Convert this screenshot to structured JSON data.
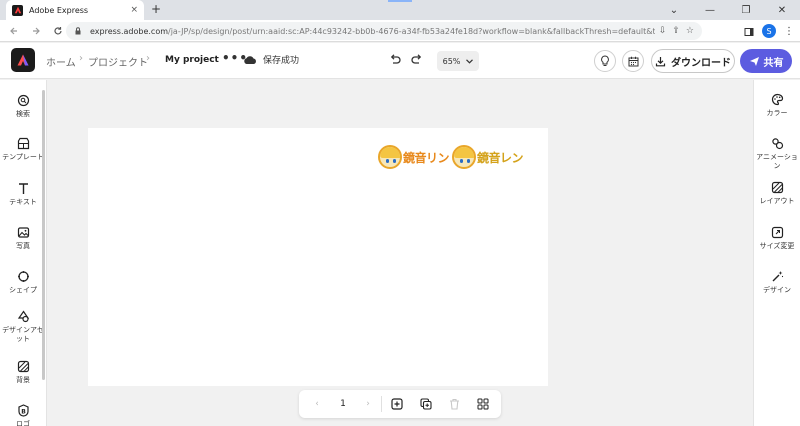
{
  "browser": {
    "tab_title": "Adobe Express",
    "tab_close": "×",
    "new_tab": "+",
    "url_host": "express.adobe.com",
    "url_path": "/ja-JP/sp/design/post/urn:aaid:sc:AP:44c93242-bb0b-4676-a34f-fb53a24fe18d?workflow=blank&fallbackThresh=default&trigger=CreateProject...",
    "profile_initial": "S",
    "win_minimize": "⌄",
    "win_min": "—",
    "win_restore": "❐",
    "win_close": "✕"
  },
  "header": {
    "crumb_home": "ホーム",
    "crumb_project": "プロジェクト",
    "crumb_current": "My project",
    "more": "•••",
    "save_status": "保存成功",
    "zoom": "65%",
    "download": "ダウンロード",
    "share": "共有"
  },
  "left_rail": {
    "items": [
      {
        "label": "検索",
        "icon": "search-icon"
      },
      {
        "label": "テンプレート",
        "icon": "template-icon"
      },
      {
        "label": "テキスト",
        "icon": "text-icon"
      },
      {
        "label": "写真",
        "icon": "photo-icon"
      },
      {
        "label": "シェイプ",
        "icon": "shape-icon"
      },
      {
        "label": "デザインアセット",
        "icon": "design-asset-icon"
      },
      {
        "label": "背景",
        "icon": "background-icon"
      },
      {
        "label": "ロゴ",
        "icon": "logo-icon"
      }
    ]
  },
  "right_rail": {
    "items": [
      {
        "label": "カラー",
        "icon": "palette-icon"
      },
      {
        "label": "アニメーション",
        "icon": "animation-icon"
      },
      {
        "label": "レイアウト",
        "icon": "layout-icon"
      },
      {
        "label": "サイズ変更",
        "icon": "resize-icon"
      },
      {
        "label": "デザイン",
        "icon": "magic-wand-icon"
      }
    ]
  },
  "canvas": {
    "logos": [
      {
        "text": "鏡音リン",
        "color": "#e8891c"
      },
      {
        "text": "鏡音レン",
        "color": "#d4a21a"
      }
    ]
  },
  "pagebar": {
    "prev": "‹",
    "page": "1",
    "next": "›"
  },
  "colors": {
    "accent": "#5c5ce0",
    "browser_chrome": "#dee1e6",
    "canvas_bg": "#f1f1f1"
  }
}
